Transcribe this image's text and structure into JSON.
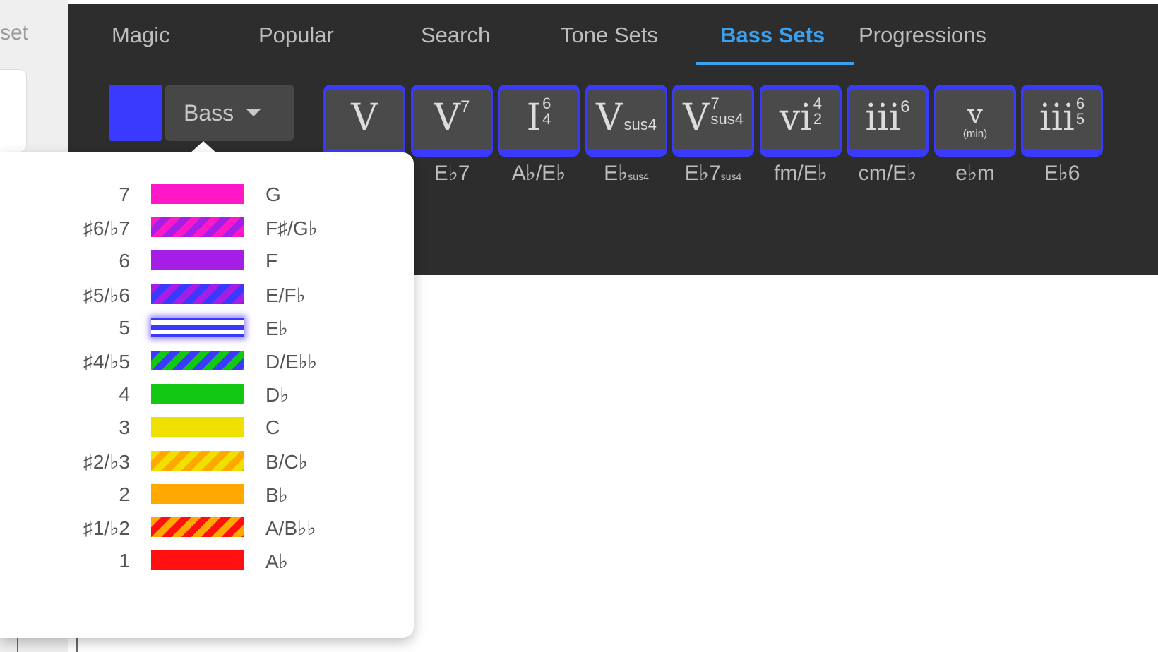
{
  "left_panel": {
    "fragment_text": "set"
  },
  "tabs": [
    {
      "label": "Magic",
      "active": false
    },
    {
      "label": "Popular",
      "active": false
    },
    {
      "label": "Search",
      "active": false
    },
    {
      "label": "Tone Sets",
      "active": false
    },
    {
      "label": "Bass Sets",
      "active": true
    },
    {
      "label": "Progressions",
      "active": false
    }
  ],
  "toolbar": {
    "swatch_color": "#3a3aff",
    "dropdown_label": "Bass"
  },
  "chords": [
    {
      "numeral": "V",
      "figure_top": "",
      "figure_bottom": "",
      "sub": "",
      "under": "",
      "name": ""
    },
    {
      "numeral": "V",
      "sup": "7",
      "name": "E♭7"
    },
    {
      "numeral": "I",
      "figure_top": "6",
      "figure_bottom": "4",
      "name": "A♭/E♭"
    },
    {
      "numeral": "V",
      "sub": "sus4",
      "name": "E♭",
      "name_small": "sus4"
    },
    {
      "numeral": "V",
      "figure_top": "7",
      "figure_bottom": "sus4",
      "name": "E♭7",
      "name_small": "sus4"
    },
    {
      "numeral": "vi",
      "figure_top": "4",
      "figure_bottom": "2",
      "name": "fm/E♭"
    },
    {
      "numeral": "iii",
      "sup": "6",
      "name": "cm/E♭"
    },
    {
      "numeral": "v",
      "under": "(min)",
      "name": "e♭m"
    },
    {
      "numeral": "iii",
      "figure_top": "6",
      "figure_bottom": "5",
      "name": "E♭6"
    }
  ],
  "bass_legend": [
    {
      "degree": "7",
      "note": "G",
      "color": "#ff18c8",
      "color2": "",
      "pattern": "solid"
    },
    {
      "degree": "♯6/♭7",
      "note": "F♯/G♭",
      "color": "#ff18c8",
      "color2": "#a41ee6",
      "pattern": "stripe"
    },
    {
      "degree": "6",
      "note": "F",
      "color": "#a41ee6",
      "color2": "",
      "pattern": "solid"
    },
    {
      "degree": "♯5/♭6",
      "note": "E/F♭",
      "color": "#a41ee6",
      "color2": "#3a3aff",
      "pattern": "stripe"
    },
    {
      "degree": "5",
      "note": "E♭",
      "color": "#3a3aff",
      "color2": "#ffffff",
      "pattern": "selected"
    },
    {
      "degree": "♯4/♭5",
      "note": "D/E♭♭",
      "color": "#3a3aff",
      "color2": "#12c812",
      "pattern": "stripe"
    },
    {
      "degree": "4",
      "note": "D♭",
      "color": "#12c812",
      "color2": "",
      "pattern": "solid"
    },
    {
      "degree": "3",
      "note": "C",
      "color": "#f0e000",
      "color2": "",
      "pattern": "solid"
    },
    {
      "degree": "♯2/♭3",
      "note": "B/C♭",
      "color": "#f0e000",
      "color2": "#ffa800",
      "pattern": "stripe"
    },
    {
      "degree": "2",
      "note": "B♭",
      "color": "#ffa800",
      "color2": "",
      "pattern": "solid"
    },
    {
      "degree": "♯1/♭2",
      "note": "A/B♭♭",
      "color": "#ffa800",
      "color2": "#ff1010",
      "pattern": "stripe"
    },
    {
      "degree": "1",
      "note": "A♭",
      "color": "#ff1010",
      "color2": "",
      "pattern": "solid"
    }
  ]
}
